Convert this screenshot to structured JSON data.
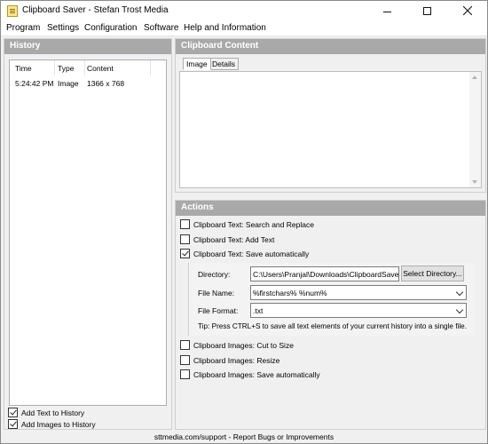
{
  "window": {
    "title": "Clipboard Saver - Stefan Trost Media",
    "icon": "clipboard-app-icon"
  },
  "menu": [
    {
      "label": "Program"
    },
    {
      "label": "Settings"
    },
    {
      "label": "Configuration"
    },
    {
      "label": "Software"
    },
    {
      "label": "Help and Information"
    }
  ],
  "history": {
    "header": "History",
    "columns": [
      "Time",
      "Type",
      "Content"
    ],
    "rows": [
      {
        "time": "5:24:42 PM",
        "type": "Image",
        "content": "1366 x 768"
      }
    ],
    "options": [
      {
        "label": "Add Text to History",
        "checked": true
      },
      {
        "label": "Add Images to History",
        "checked": true
      }
    ]
  },
  "clipboard": {
    "header": "Clipboard Content",
    "tabs": [
      "Image",
      "Details"
    ],
    "active_tab": "Image"
  },
  "actions": {
    "header": "Actions",
    "items": [
      {
        "label": "Clipboard Text: Search and Replace",
        "checked": false
      },
      {
        "label": "Clipboard Text: Add Text",
        "checked": false
      },
      {
        "label": "Clipboard Text: Save automatically",
        "checked": true
      },
      {
        "label": "Clipboard Images: Cut to Size",
        "checked": false
      },
      {
        "label": "Clipboard Images: Resize",
        "checked": false
      },
      {
        "label": "Clipboard Images: Save automatically",
        "checked": false
      }
    ],
    "save_settings": {
      "directory_label": "Directory:",
      "directory_value": "C:\\Users\\Pranjal\\Downloads\\ClipboardSaver\\",
      "select_directory_button": "Select Directory...",
      "file_name_label": "File Name:",
      "file_name_value": "%firstchars% %num%",
      "file_format_label": "File Format:",
      "file_format_value": ".txt",
      "tip": "Tip: Press CTRL+S to save all text elements of your current history into a single file."
    }
  },
  "status": "sttmedia.com/support - Report Bugs or Improvements"
}
